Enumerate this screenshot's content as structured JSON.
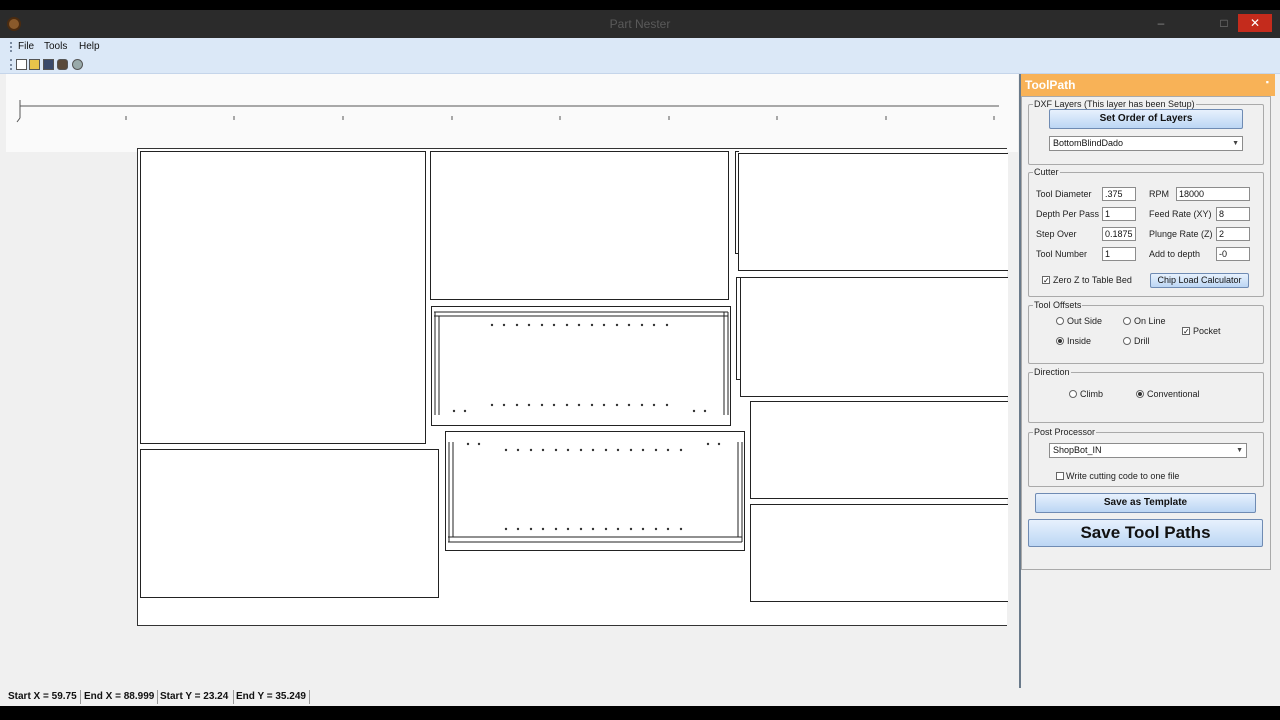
{
  "window": {
    "title": "Part Nester",
    "minimize": "‒",
    "maximize": "□",
    "close": "✕"
  },
  "menu": {
    "file": "File",
    "tools": "Tools",
    "help": "Help"
  },
  "toolbar": {
    "icons": [
      "new-file-icon",
      "open-folder-icon",
      "save-icon",
      "print-icon",
      "settings-icon"
    ]
  },
  "toolpath_panel": {
    "title": "ToolPath",
    "pin": "▪",
    "dxf_layers": {
      "legend": "DXF Layers  (This layer has been Setup)",
      "set_order_button": "Set Order of Layers",
      "layer_selected": "BottomBlindDado"
    },
    "cutter": {
      "legend": "Cutter",
      "tool_diameter_label": "Tool Diameter",
      "tool_diameter": ".375",
      "rpm_label": "RPM",
      "rpm": "18000",
      "depth_per_pass_label": "Depth Per Pass",
      "depth_per_pass": "1",
      "feed_rate_label": "Feed Rate (XY)",
      "feed_rate": "8",
      "step_over_label": "Step Over",
      "step_over": "0.1875",
      "plunge_rate_label": "Plunge Rate (Z)",
      "plunge_rate": "2",
      "tool_number_label": "Tool Number",
      "tool_number": "1",
      "add_to_depth_label": "Add to depth",
      "add_to_depth": "-0",
      "zero_z_label": "Zero Z to Table Bed",
      "zero_z_checked": true,
      "chip_load_button": "Chip Load Calculator"
    },
    "tool_offsets": {
      "legend": "Tool Offsets",
      "out_side": "Out Side",
      "on_line": "On Line",
      "pocket": "Pocket",
      "inside": "Inside",
      "drill": "Drill",
      "selected": "inside",
      "pocket_checked": true
    },
    "direction": {
      "legend": "Direction",
      "climb": "Climb",
      "conventional": "Conventional",
      "selected": "conventional"
    },
    "post_processor": {
      "legend": "Post Processor",
      "selected": "ShopBot_IN",
      "one_file_label": "Write cutting code to one file",
      "one_file_checked": false
    },
    "save_template_button": "Save as Template",
    "save_toolpaths_button": "Save Tool Paths"
  },
  "status": {
    "start_x": "Start X = 59.75",
    "end_x": "End X = 88.999",
    "start_y": "Start Y = 23.24",
    "end_y": "End Y = 35.249"
  }
}
